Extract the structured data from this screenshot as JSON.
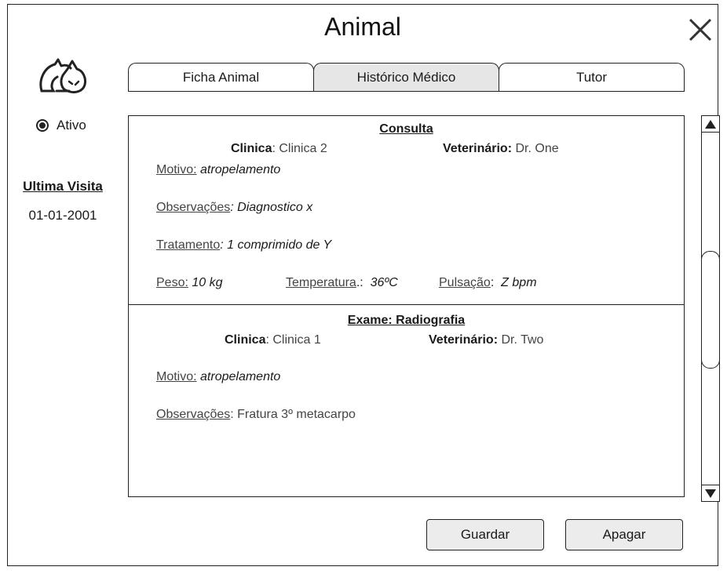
{
  "window": {
    "title": "Animal"
  },
  "sidebar": {
    "status": {
      "label": "Ativo",
      "selected": true
    },
    "last_visit": {
      "label": "Ultima Visita",
      "date": "01-01-2001"
    }
  },
  "tabs": [
    {
      "label": "Ficha Animal",
      "active": false
    },
    {
      "label": "Histórico Médico",
      "active": true
    },
    {
      "label": "Tutor",
      "active": false
    }
  ],
  "records": [
    {
      "title": "Consulta",
      "clinic_label": "Clinica",
      "clinic_value": ": Clinica 2",
      "vet_label": "Veterinário:",
      "vet_value": " Dr. One",
      "motivo_label": "Motivo:",
      "motivo_value": " atropelamento",
      "obs_label": "Observações",
      "obs_value": ": Diagnostico x",
      "trat_label": "Tratamento",
      "trat_value": ": 1 comprimido de Y",
      "peso_label": "Peso:",
      "peso_value": " 10 kg",
      "temp_label": "Temperatura",
      "temp_sep": ".:",
      "temp_value": "36ºC",
      "pulse_label": "Pulsação",
      "pulse_sep": ":",
      "pulse_value": "Z bpm"
    },
    {
      "title": "Exame: Radiografia",
      "clinic_label": "Clinica",
      "clinic_value": ": Clinica 1",
      "vet_label": "Veterinário:",
      "vet_value": " Dr. Two",
      "motivo_label": "Motivo:",
      "motivo_value": " atropelamento",
      "obs_label": "Observações",
      "obs_value": ": Fratura 3º metacarpo"
    }
  ],
  "actions": {
    "save_label": "Guardar",
    "delete_label": "Apagar"
  },
  "icons": {
    "close": "close-icon",
    "logo": "cat-dog-logo-icon",
    "scroll_up": "arrow-up-icon",
    "scroll_down": "arrow-down-icon"
  }
}
